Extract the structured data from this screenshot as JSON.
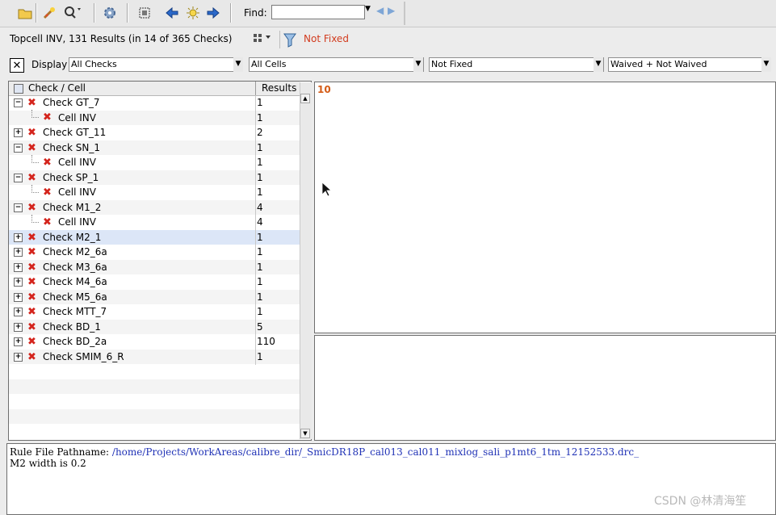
{
  "toolbar": {
    "buttons": [
      {
        "name": "open-folder-icon"
      },
      {
        "name": "highlight-wand-icon"
      },
      {
        "name": "zoom-icon"
      },
      {
        "name": "settings-gear-icon"
      },
      {
        "name": "grid-select-icon"
      },
      {
        "name": "arrow-left-icon"
      },
      {
        "name": "sun-icon"
      },
      {
        "name": "arrow-right-icon"
      }
    ],
    "find_label": "Find:",
    "find_value": ""
  },
  "status": {
    "summary": "Topcell INV, 131 Results (in 14 of 365 Checks)",
    "filter_label": "Not Fixed"
  },
  "filters": {
    "display_label": "Display",
    "checks": "All Checks",
    "cells": "All Cells",
    "fixed": "Not Fixed",
    "waived": "Waived + Not Waived"
  },
  "tree": {
    "header_name": "Check / Cell",
    "header_results": "Results",
    "rows": [
      {
        "label": "Check GT_7",
        "result": "1"
      },
      {
        "label": "Cell INV",
        "result": "1"
      },
      {
        "label": "Check GT_11",
        "result": "2"
      },
      {
        "label": "Check SN_1",
        "result": "1"
      },
      {
        "label": "Cell INV",
        "result": "1"
      },
      {
        "label": "Check SP_1",
        "result": "1"
      },
      {
        "label": "Cell INV",
        "result": "1"
      },
      {
        "label": "Check M1_2",
        "result": "4"
      },
      {
        "label": "Cell INV",
        "result": "4"
      },
      {
        "label": "Check M2_1",
        "result": "1"
      },
      {
        "label": "Check M2_6a",
        "result": "1"
      },
      {
        "label": "Check M3_6a",
        "result": "1"
      },
      {
        "label": "Check M4_6a",
        "result": "1"
      },
      {
        "label": "Check M5_6a",
        "result": "1"
      },
      {
        "label": "Check MTT_7",
        "result": "1"
      },
      {
        "label": "Check BD_1",
        "result": "5"
      },
      {
        "label": "Check BD_2a",
        "result": "110"
      },
      {
        "label": "Check SMIM_6_R",
        "result": "1"
      }
    ]
  },
  "detail": {
    "count": "10"
  },
  "info": {
    "prefix": "Rule File Pathname: ",
    "path": "/home/Projects/WorkAreas/calibre_dir/_SmicDR18P_cal013_cal011_mixlog_sali_p1mt6_1tm_12152533.drc_",
    "message": "M2 width is 0.2"
  },
  "watermark": "CSDN @林清海笙"
}
